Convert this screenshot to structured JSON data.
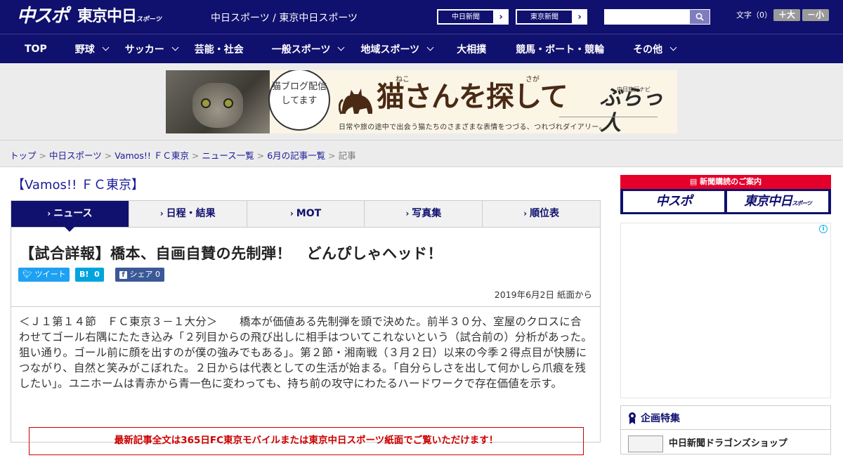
{
  "header": {
    "logo_chuspo": "中スポ",
    "logo_tokyo": "東京中日",
    "logo_tokyo_small": "スポーツ",
    "site_name": "中日スポーツ / 東京中日スポーツ",
    "paper_links": [
      {
        "label": "中日新聞"
      },
      {
        "label": "東京新聞"
      }
    ],
    "search": {
      "placeholder": "",
      "value": ""
    },
    "font_size": {
      "label": "文字（0）",
      "larger": "＋大",
      "smaller": "－小"
    }
  },
  "nav": [
    {
      "label": "TOP",
      "has_menu": false
    },
    {
      "label": "野球",
      "has_menu": true
    },
    {
      "label": "サッカー",
      "has_menu": true
    },
    {
      "label": "芸能・社会",
      "has_menu": false
    },
    {
      "label": "一般スポーツ",
      "has_menu": true
    },
    {
      "label": "地域スポーツ",
      "has_menu": true
    },
    {
      "label": "大相撲",
      "has_menu": false
    },
    {
      "label": "競馬・ボート・競輪",
      "has_menu": false
    },
    {
      "label": "その他",
      "has_menu": true
    }
  ],
  "banner": {
    "bubble_text": "猫ブログ配信してます",
    "title": "猫さんを探して",
    "ruby_neko": "ねこ",
    "ruby_saga": "さが",
    "brand": "ぶらっ人",
    "brand_small": "中日旅行ナビ",
    "subtitle": "日常や旅の途中で出会う猫たちのさまざまな表情をつづる、つれづれダイアリー。"
  },
  "breadcrumb": [
    {
      "label": "トップ",
      "link": true
    },
    {
      "label": "中日スポーツ",
      "link": true
    },
    {
      "label": "Vamos!! ＦＣ東京",
      "link": true
    },
    {
      "label": "ニュース一覧",
      "link": true
    },
    {
      "label": "6月の記事一覧",
      "link": true
    },
    {
      "label": "記事",
      "link": false
    }
  ],
  "section_title": "【Vamos!! ＦＣ東京】",
  "tabs": [
    {
      "label": "ニュース",
      "active": true
    },
    {
      "label": "日程・結果",
      "active": false
    },
    {
      "label": "MOT",
      "active": false
    },
    {
      "label": "写真集",
      "active": false
    },
    {
      "label": "順位表",
      "active": false
    }
  ],
  "article": {
    "headline": "【試合詳報】橋本、自画自賛の先制弾！　どんぴしゃヘッド！",
    "share": {
      "tweet": "ツイート",
      "hatena_label": "B!",
      "hatena_count": "0",
      "fb_label": "シェア",
      "fb_count": "0"
    },
    "date": "2019年6月2日 紙面から",
    "body": "＜Ｊ１第１４節　ＦＣ東京３－１大分＞　　橋本が価値ある先制弾を頭で決めた。前半３０分、室屋のクロスに合わせてゴール右隅にたたき込み「２列目からの飛び出しに相手はついてこれないという（試合前の）分析があった。狙い通り。ゴール前に顔を出すのが僕の強みでもある」。第２節・湘南戦（３月２日）以来の今季２得点目が快勝につながり、自然と笑みがこぼれた。２日からは代表としての生活が始まる。「自分らしさを出して何かしら爪痕を残したい」。ユニホームは青赤から青一色に変わっても、持ち前の攻守にわたるハードワークで存在価値を示す。",
    "notice": "最新記事全文は365日FC東京モバイルまたは東京中日スポーツ紙面でご覧いただけます！"
  },
  "sidebar": {
    "subscribe_head": "新聞購読のご案内",
    "subscribe_logos": [
      "中スポ",
      "東京中日"
    ],
    "subscribe_logo_small": "スポーツ",
    "feature_title": "企画特集",
    "feature_item": "中日新聞ドラゴンズショップ"
  },
  "colors": {
    "navy": "#10106e",
    "accent_red": "#e4002b",
    "link": "#1a1a99"
  }
}
